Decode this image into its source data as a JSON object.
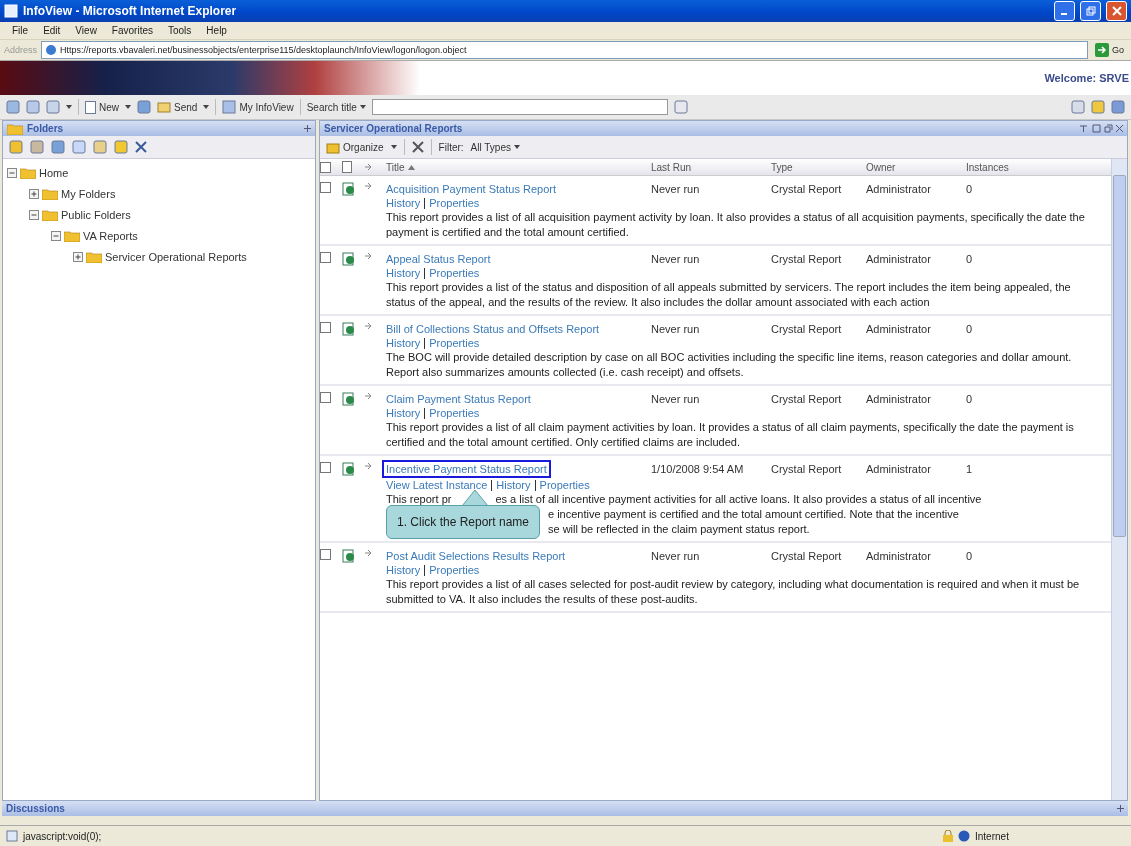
{
  "window": {
    "title": "InfoView - Microsoft Internet Explorer"
  },
  "menu": [
    "File",
    "Edit",
    "View",
    "Favorites",
    "Tools",
    "Help"
  ],
  "address": {
    "label": "Address",
    "value": "Https://reports.vbavaleri.net/businessobjects/enterprise115/desktoplaunch/InfoView/logon/logon.object",
    "go": "Go"
  },
  "banner": {
    "welcome": "Welcome: SRVE"
  },
  "toolbar": {
    "new": "New",
    "send": "Send",
    "my_infoview": "My InfoView",
    "search_label": "Search title"
  },
  "folders_panel": {
    "title": "Folders",
    "tree": [
      {
        "label": "Home",
        "expanded": true,
        "children": [
          {
            "label": "My Folders",
            "expanded": false
          },
          {
            "label": "Public Folders",
            "expanded": true,
            "children": [
              {
                "label": "VA Reports",
                "expanded": true,
                "children": [
                  {
                    "label": "Servicer Operational Reports",
                    "expanded": false
                  }
                ]
              }
            ]
          }
        ]
      }
    ]
  },
  "reports_panel": {
    "title": "Servicer Operational Reports",
    "organize": "Organize",
    "filter_label": "Filter:",
    "filter_value": "All Types",
    "all_checked": false,
    "columns": [
      "Title",
      "Last Run",
      "Type",
      "Owner",
      "Instances"
    ],
    "rows": [
      {
        "title": "Acquisition Payment Status Report",
        "checked": false,
        "highlighted": false,
        "links": [
          "History",
          "Properties"
        ],
        "last_run": "Never run",
        "type": "Crystal Report",
        "owner": "Administrator",
        "instances": "0",
        "description": "This report provides a list of all acquisition payment activity by loan. It also provides a status of all acquisition payments, specifically the date the payment is certified and the total amount certified."
      },
      {
        "title": "Appeal Status Report",
        "checked": false,
        "highlighted": false,
        "links": [
          "History",
          "Properties"
        ],
        "last_run": "Never run",
        "type": "Crystal Report",
        "owner": "Administrator",
        "instances": "0",
        "description": "This report provides a list of the status and disposition of all appeals submitted by servicers. The report includes the item being appealed, the status of the appeal, and the results of the review. It also includes the dollar amount associated with each action"
      },
      {
        "title": "Bill of Collections Status and Offsets Report",
        "checked": false,
        "highlighted": false,
        "links": [
          "History",
          "Properties"
        ],
        "last_run": "Never run",
        "type": "Crystal Report",
        "owner": "Administrator",
        "instances": "0",
        "description": "The BOC will provide detailed description by case on all BOC activities including the specific line items, reason categories and dollar amount. Report also summarizes amounts collected (i.e. cash receipt) and offsets."
      },
      {
        "title": "Claim Payment Status Report",
        "checked": false,
        "highlighted": false,
        "links": [
          "History",
          "Properties"
        ],
        "last_run": "Never run",
        "type": "Crystal Report",
        "owner": "Administrator",
        "instances": "0",
        "description": "This report provides a list of all claim payment activities by loan. It provides a status of all claim payments, specifically the date the payment is certified and the total amount certified. Only certified claims are included."
      },
      {
        "title": "Incentive Payment Status Report",
        "checked": false,
        "highlighted": true,
        "links": [
          "View Latest Instance",
          "History",
          "Properties"
        ],
        "last_run": "1/10/2008 9:54 AM",
        "type": "Crystal Report",
        "owner": "Administrator",
        "instances": "1",
        "description_parts": [
          {
            "left": "This report pr",
            "right": "es a list of all incentive payment activities for all active loans. It also provides a status of all incentive"
          },
          {
            "right": "e incentive payment is certified and the total amount certified. Note that the incentive"
          },
          {
            "right": "se will be reflected in the claim payment status report."
          }
        ],
        "callout": "1. Click the Report name"
      },
      {
        "title": "Post Audit Selections Results Report",
        "checked": false,
        "highlighted": false,
        "links": [
          "History",
          "Properties"
        ],
        "last_run": "Never run",
        "type": "Crystal Report",
        "owner": "Administrator",
        "instances": "0",
        "description": "This report provides a list of all cases selected for post-audit review by category, including what documentation is required and when it must be submitted to VA. It also includes the results of these post-audits."
      }
    ]
  },
  "discussions": {
    "title": "Discussions"
  },
  "status_bar": {
    "text": "javascript:void(0);",
    "zone": "Internet"
  }
}
